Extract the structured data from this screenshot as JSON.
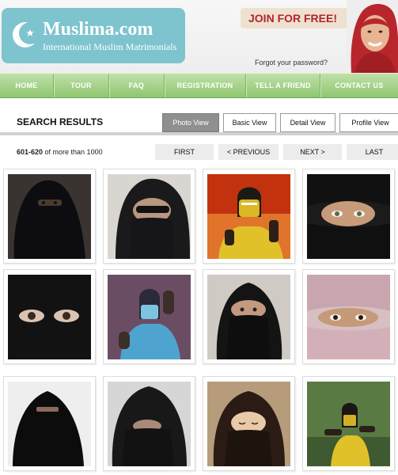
{
  "header": {
    "logo_title": "Muslima.com",
    "logo_tagline": "International Muslim Matrimonials",
    "join_label": "JOIN FOR FREE!",
    "forgot_password": "Forgot your password?"
  },
  "nav": {
    "items": [
      {
        "label": "HOME"
      },
      {
        "label": "TOUR"
      },
      {
        "label": "FAQ"
      },
      {
        "label": "REGISTRATION"
      },
      {
        "label": "TELL A FRIEND"
      },
      {
        "label": "CONTACT US"
      }
    ]
  },
  "results": {
    "title": "SEARCH RESULTS",
    "views": [
      {
        "label": "Photo View",
        "active": true
      },
      {
        "label": "Basic View",
        "active": false
      },
      {
        "label": "Detail View",
        "active": false
      },
      {
        "label": "Profile View",
        "active": false
      }
    ],
    "range_bold": "601-620",
    "range_rest": " of more than 1000",
    "pager": {
      "first": "FIRST",
      "previous": "< PREVIOUS",
      "next": "NEXT >",
      "last": "LAST"
    }
  },
  "photos": [
    {
      "subject": "person in black niqab, dark background"
    },
    {
      "subject": "person in black scarf with sunglasses"
    },
    {
      "subject": "yellow masked ninja fighter, fire background"
    },
    {
      "subject": "woman in black niqab with light eyes"
    },
    {
      "subject": "close-up eyes through black veil"
    },
    {
      "subject": "blue masked ninja fighter"
    },
    {
      "subject": "woman in black hijab covering face"
    },
    {
      "subject": "woman in pink hijab and veil"
    },
    {
      "subject": "person in black niqab, white background"
    },
    {
      "subject": "person in black hijab with face covered"
    },
    {
      "subject": "woman in brown hijab, eyes closed"
    },
    {
      "subject": "yellow masked ninja fighter, outdoors"
    }
  ],
  "colors": {
    "logo_bg": "#7ec4ce",
    "join_text": "#b0262e",
    "nav_green": "#8fc670",
    "active_tab": "#8f8f8f"
  }
}
